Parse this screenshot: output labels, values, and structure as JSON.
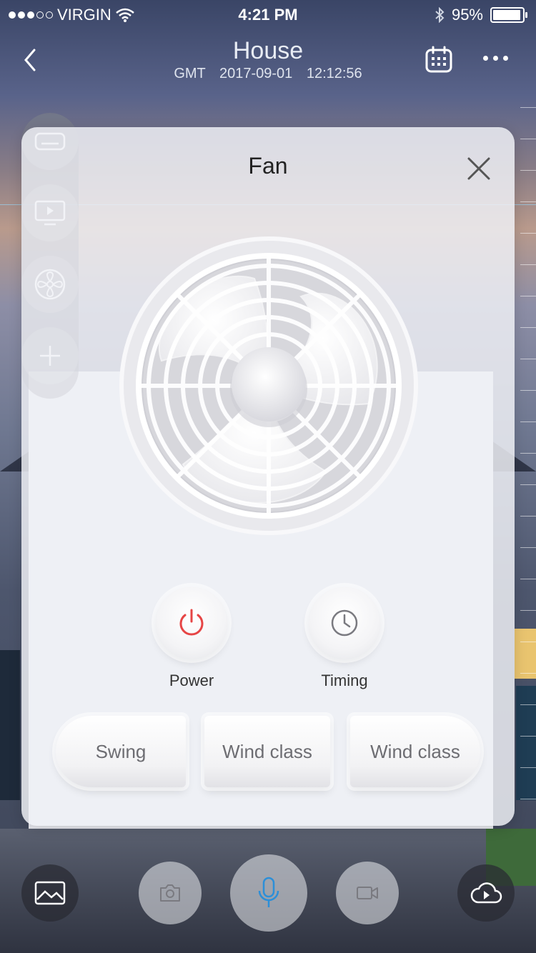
{
  "status_bar": {
    "carrier": "VIRGIN",
    "signal_bars": 3,
    "signal_total": 5,
    "time": "4:21 PM",
    "battery": "95%",
    "battery_level": 0.95
  },
  "nav": {
    "title": "House",
    "timestamp": "GMT   2017-09-01   12:12:56"
  },
  "modal": {
    "title": "Fan",
    "power_label": "Power",
    "timing_label": "Timing",
    "modes": [
      "Swing",
      "Wind class",
      "Wind class"
    ]
  },
  "colors": {
    "power_icon": "#e64545",
    "mic_icon": "#2c8fd8",
    "icon_gray": "#7a7a80"
  },
  "icons": {
    "back": "chevron-left-icon",
    "calendar": "calendar-icon",
    "more": "more-icon",
    "close": "close-icon",
    "power": "power-icon",
    "timing": "clock-icon",
    "gallery": "image-icon",
    "snapshot": "camera-icon",
    "talk": "microphone-icon",
    "record": "video-icon",
    "cloud": "cloud-play-icon"
  }
}
